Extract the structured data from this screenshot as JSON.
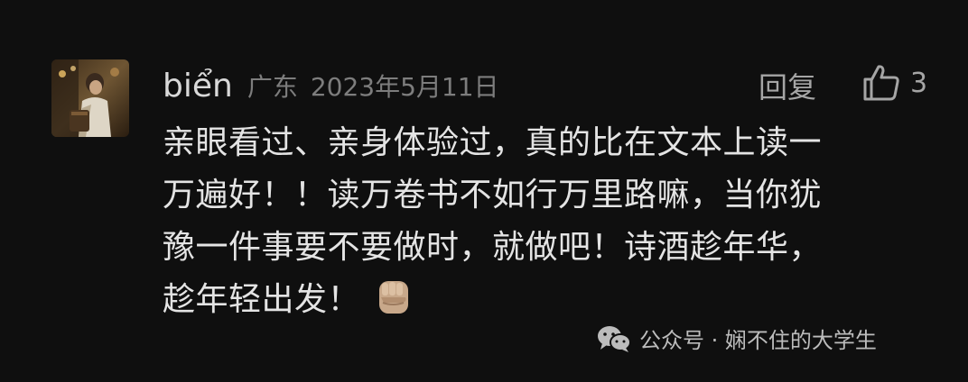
{
  "comment": {
    "username": "biển",
    "location": "广东",
    "date": "2023年5月11日",
    "reply_label": "回复",
    "like_count": "3",
    "lines": [
      "亲眼看过、亲身体验过，真的比在文本上读一",
      "万遍好！！读万卷书不如行万里路嘛，当你犹",
      "豫一件事要不要做时，就做吧！诗酒趁年华，",
      "趁年轻出发！"
    ],
    "emoji_icon": "raised-fist-icon"
  },
  "watermark": {
    "text": "公众号 · 娴不住的大学生",
    "icon": "wechat-icon"
  }
}
